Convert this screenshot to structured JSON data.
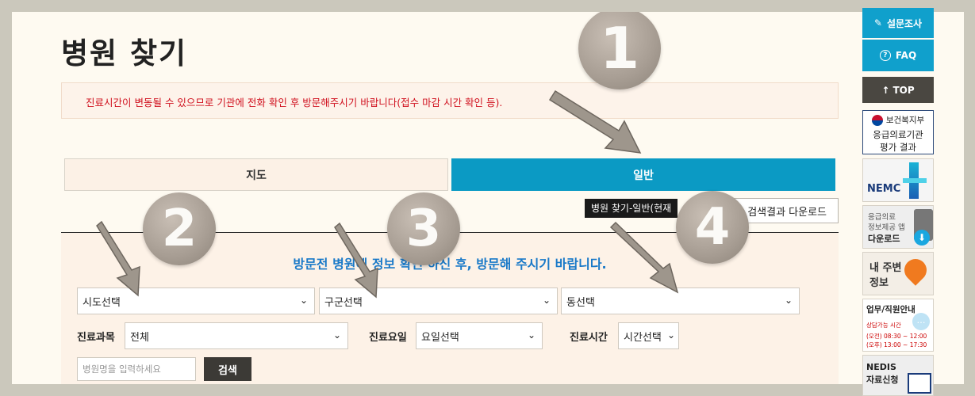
{
  "page": {
    "title": "병원 찾기",
    "notice": "진료시간이 변동될 수 있으므로 기관에 전화 확인 후 방문해주시기 바랍니다(접수 마감 시간 확인 등)."
  },
  "tabs": [
    {
      "label": "지도",
      "active": false
    },
    {
      "label": "일반",
      "active": true
    }
  ],
  "tooltip": "병원 찾기-일반(현재",
  "download_button": "검색결과 다운로드",
  "guide_text": "방문전 병원에 정보 확인 하신 후, 방문해 주시기 바랍니다.",
  "region_selects": {
    "sido": "시도선택",
    "gugun": "구군선택",
    "dong": "동선택"
  },
  "filters": {
    "department_label": "진료과목",
    "department_value": "전체",
    "day_label": "진료요일",
    "day_value": "요일선택",
    "time_label": "진료시간",
    "time_value": "시간선택"
  },
  "search": {
    "placeholder": "병원명을 입력하세요",
    "button": "검색"
  },
  "annotations": [
    "1",
    "2",
    "3",
    "4"
  ],
  "sidebar": {
    "survey": "설문조사",
    "faq": "FAQ",
    "top": "TOP",
    "ministry_org": "보건복지부",
    "ministry_line1": "응급의료기관",
    "ministry_line2": "평가 결과",
    "nemc": "NEMC",
    "app_line1": "응급의료",
    "app_line2": "정보제공 앱",
    "app_line3": "다운로드",
    "nearby_line1": "내 주변",
    "nearby_line2": "정보",
    "contact_title": "업무/직원안내",
    "contact_hours_title": "상담가능 시간",
    "contact_am": "(오전) 08:30 ~ 12:00",
    "contact_pm": "(오후) 13:00 ~ 17:30",
    "nedis_line1": "NEDIS",
    "nedis_line2": "자료신청"
  },
  "colors": {
    "accent": "#0b9ac4",
    "notice_text": "#d0101e",
    "guide_text": "#1979c8",
    "page_bg": "#fefaf1"
  }
}
